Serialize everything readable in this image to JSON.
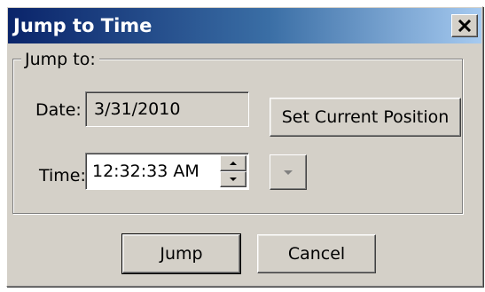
{
  "window": {
    "title": "Jump to Time",
    "close_icon": "close-icon"
  },
  "group": {
    "legend": "Jump to:"
  },
  "date": {
    "label": "Date:",
    "value": "3/31/2010",
    "set_current_label": "Set Current Position"
  },
  "time": {
    "label": "Time:",
    "value": "12:32:33 AM",
    "spin_up_icon": "arrow-up-icon",
    "spin_down_icon": "arrow-down-icon",
    "dropdown_icon": "chevron-down-icon"
  },
  "buttons": {
    "jump_label": "Jump",
    "cancel_label": "Cancel"
  },
  "colors": {
    "titlebar_start": "#0a246a",
    "titlebar_end": "#a6caf0",
    "face": "#d4d0c8",
    "disabled_glyph": "#808080"
  }
}
